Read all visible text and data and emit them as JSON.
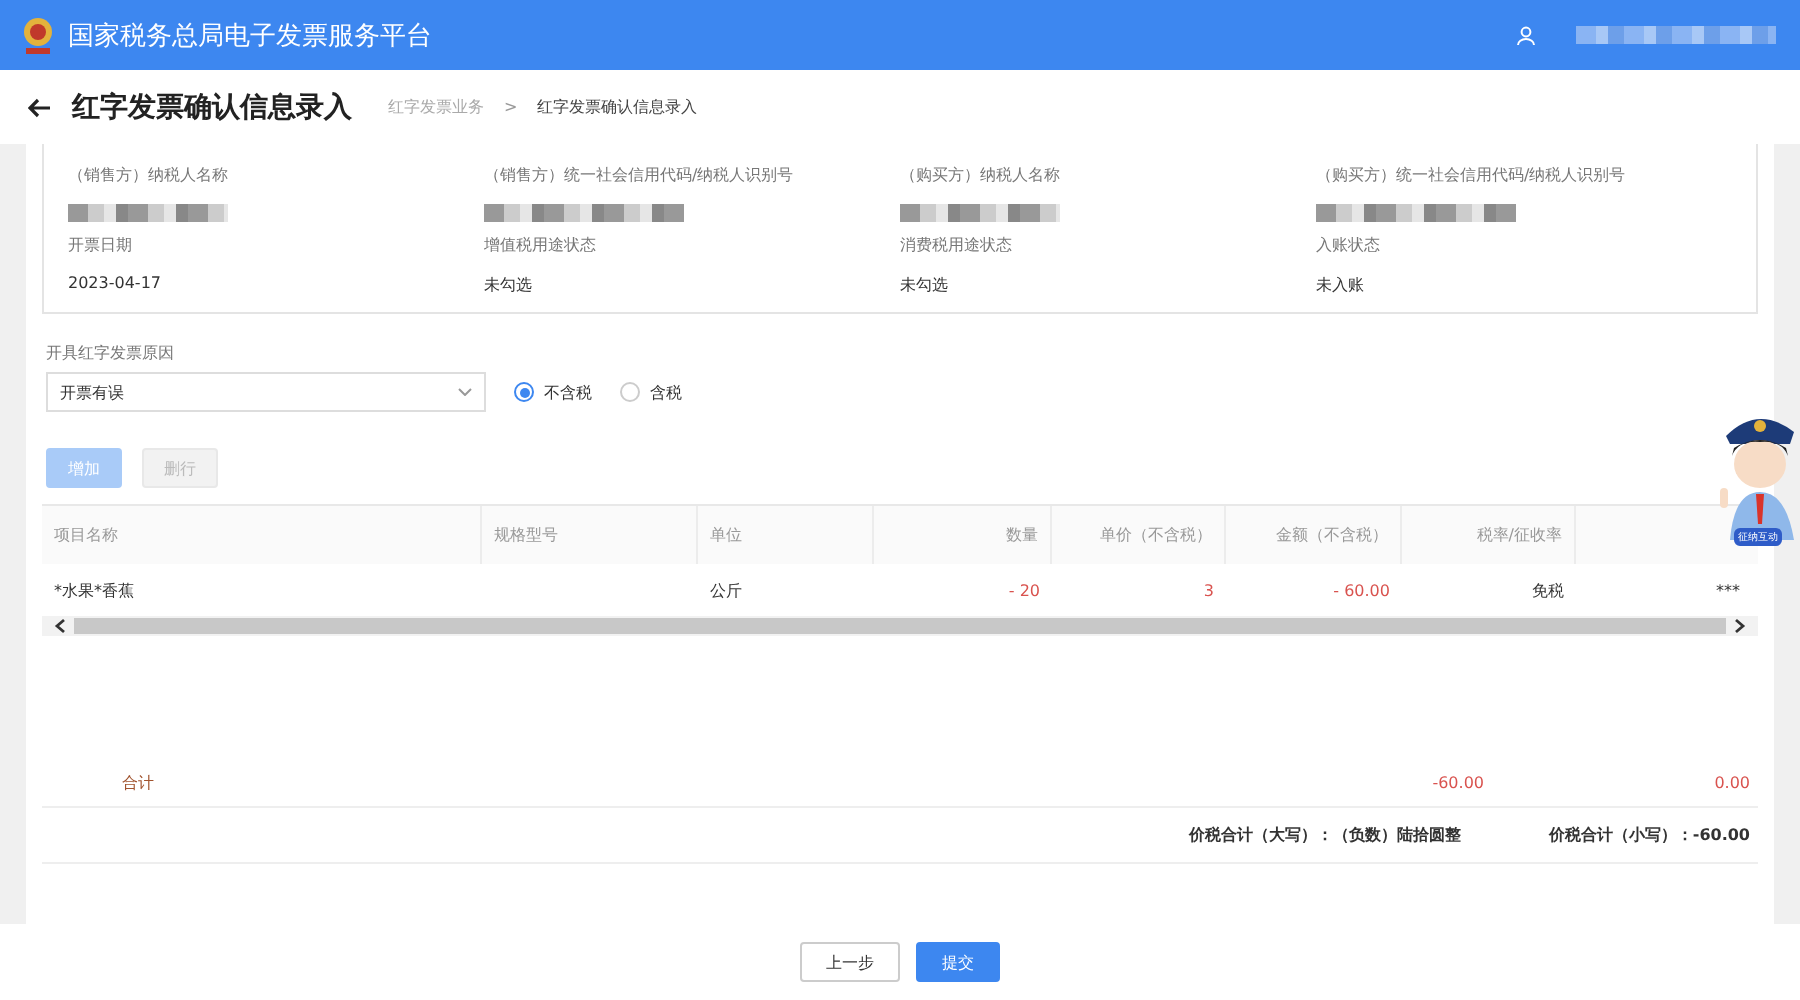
{
  "header": {
    "title": "国家税务总局电子发票服务平台"
  },
  "page": {
    "title": "红字发票确认信息录入",
    "separator": ">",
    "breadcrumb": [
      {
        "label": "红字发票业务",
        "current": false
      },
      {
        "label": "红字发票确认信息录入",
        "current": true
      }
    ]
  },
  "info_fields": [
    {
      "label": "（销售方）纳税人名称",
      "value_masked": true
    },
    {
      "label": "（销售方）统一社会信用代码/纳税人识别号",
      "value_masked": true
    },
    {
      "label": "（购买方）纳税人名称",
      "value_masked": true
    },
    {
      "label": "（购买方）统一社会信用代码/纳税人识别号",
      "value_masked": true
    },
    {
      "label": "开票日期",
      "value": "2023-04-17"
    },
    {
      "label": "增值税用途状态",
      "value": "未勾选"
    },
    {
      "label": "消费税用途状态",
      "value": "未勾选"
    },
    {
      "label": "入账状态",
      "value": "未入账"
    }
  ],
  "reason": {
    "label": "开具红字发票原因",
    "value": "开票有误"
  },
  "tax_mode": [
    {
      "label": "不含税",
      "selected": true
    },
    {
      "label": "含税",
      "selected": false
    }
  ],
  "row_buttons": [
    {
      "label": "增加",
      "kind": "primary",
      "disabled": true
    },
    {
      "label": "删行",
      "kind": "default",
      "disabled": true
    }
  ],
  "table": {
    "columns": [
      {
        "label": "项目名称",
        "kind": "text"
      },
      {
        "label": "规格型号",
        "kind": "text"
      },
      {
        "label": "单位",
        "kind": "text"
      },
      {
        "label": "数量",
        "kind": "number"
      },
      {
        "label": "单价（不含税）",
        "kind": "number"
      },
      {
        "label": "金额（不含税）",
        "kind": "number"
      },
      {
        "label": "税率/征收率",
        "kind": "number"
      },
      {
        "kind": "number"
      }
    ],
    "rows": [
      [
        {
          "text": "*水果*香蕉"
        },
        null,
        {
          "text": "公斤"
        },
        {
          "text": "- 20",
          "color": "#d9534f"
        },
        {
          "text": "3",
          "color": "#d9534f"
        },
        {
          "text": "- 60.00",
          "color": "#d9534f"
        },
        {
          "text": "免税"
        },
        {
          "text": "***"
        }
      ]
    ]
  },
  "totals": {
    "label": "合计",
    "amount": "-60.00",
    "tax": "0.00"
  },
  "grand_total": [
    {
      "label": "价税合计（大写）：",
      "value": "（负数）陆拾圆整"
    },
    {
      "label": "价税合计（小写）：",
      "value": "-60.00"
    }
  ],
  "mascot": {
    "badge": "征纳互动"
  },
  "footer_buttons": [
    {
      "label": "上一步",
      "kind": "default"
    },
    {
      "label": "提交",
      "kind": "primary"
    }
  ]
}
